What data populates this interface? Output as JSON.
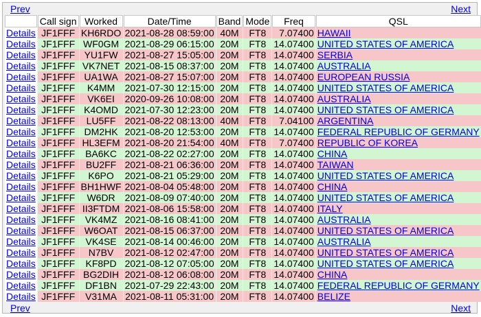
{
  "nav": {
    "prev": "Prev",
    "next": "Next"
  },
  "headers": [
    "",
    "Call sign",
    "Worked",
    "Date/Time",
    "Band",
    "Mode",
    "Freq",
    "QSL"
  ],
  "rows": [
    {
      "details": "Details",
      "call": "JF1FFF",
      "worked": "KH6RDO",
      "datetime": "2021-08-28 08:59:00",
      "band": "40M",
      "mode": "FT8",
      "freq": "7.07400",
      "qsl": "HAWAII",
      "color": "pink"
    },
    {
      "details": "Details",
      "call": "JF1FFF",
      "worked": "WF0GM",
      "datetime": "2021-08-29 06:15:00",
      "band": "20M",
      "mode": "FT8",
      "freq": "14.07400",
      "qsl": "UNITED STATES OF AMERICA",
      "color": "green"
    },
    {
      "details": "Details",
      "call": "JF1FFF",
      "worked": "YU1FW",
      "datetime": "2021-08-27 15:05:00",
      "band": "20M",
      "mode": "FT8",
      "freq": "14.07400",
      "qsl": "SERBIA",
      "color": "pink"
    },
    {
      "details": "Details",
      "call": "JF1FFF",
      "worked": "VK7NET",
      "datetime": "2021-08-15 08:37:00",
      "band": "20M",
      "mode": "FT8",
      "freq": "14.07400",
      "qsl": "AUSTRALIA",
      "color": "green"
    },
    {
      "details": "Details",
      "call": "JF1FFF",
      "worked": "UA1WA",
      "datetime": "2021-08-27 15:07:00",
      "band": "20M",
      "mode": "FT8",
      "freq": "14.07400",
      "qsl": "EUROPEAN RUSSIA",
      "color": "pink"
    },
    {
      "details": "Details",
      "call": "JF1FFF",
      "worked": "K4MM",
      "datetime": "2021-07-30 12:15:00",
      "band": "20M",
      "mode": "FT8",
      "freq": "14.07400",
      "qsl": "UNITED STATES OF AMERICA",
      "color": "green"
    },
    {
      "details": "Details",
      "call": "JF1FFF",
      "worked": "VK6EI",
      "datetime": "2020-09-26 10:08:00",
      "band": "20M",
      "mode": "FT8",
      "freq": "14.07400",
      "qsl": "AUSTRALIA",
      "color": "pink"
    },
    {
      "details": "Details",
      "call": "JF1FFF",
      "worked": "K4OMD",
      "datetime": "2021-07-30 12:23:00",
      "band": "20M",
      "mode": "FT8",
      "freq": "14.07400",
      "qsl": "UNITED STATES OF AMERICA",
      "color": "green"
    },
    {
      "details": "Details",
      "call": "JF1FFF",
      "worked": "LU5FF",
      "datetime": "2021-08-22 08:13:00",
      "band": "40M",
      "mode": "FT8",
      "freq": "7.04100",
      "qsl": "ARGENTINA",
      "color": "pink"
    },
    {
      "details": "Details",
      "call": "JF1FFF",
      "worked": "DM2HK",
      "datetime": "2021-08-20 12:53:00",
      "band": "20M",
      "mode": "FT8",
      "freq": "14.07400",
      "qsl": "FEDERAL REPUBLIC OF GERMANY",
      "color": "green"
    },
    {
      "details": "Details",
      "call": "JF1FFF",
      "worked": "HL3EFM",
      "datetime": "2021-08-20 21:54:00",
      "band": "40M",
      "mode": "FT8",
      "freq": "7.07400",
      "qsl": "REPUBLIC OF KOREA",
      "color": "pink"
    },
    {
      "details": "Details",
      "call": "JF1FFF",
      "worked": "BA6KC",
      "datetime": "2021-08-22 02:27:00",
      "band": "20M",
      "mode": "FT8",
      "freq": "14.07400",
      "qsl": "CHINA",
      "color": "green"
    },
    {
      "details": "Details",
      "call": "JF1FFF",
      "worked": "BU2FF",
      "datetime": "2021-08-21 06:36:00",
      "band": "20M",
      "mode": "FT8",
      "freq": "14.07400",
      "qsl": "TAIWAN",
      "color": "pink"
    },
    {
      "details": "Details",
      "call": "JF1FFF",
      "worked": "K6PO",
      "datetime": "2021-08-21 05:29:00",
      "band": "20M",
      "mode": "FT8",
      "freq": "14.07400",
      "qsl": "UNITED STATES OF AMERICA",
      "color": "green"
    },
    {
      "details": "Details",
      "call": "JF1FFF",
      "worked": "BH1HWF",
      "datetime": "2021-08-04 05:48:00",
      "band": "20M",
      "mode": "FT8",
      "freq": "14.07400",
      "qsl": "CHINA",
      "color": "pink"
    },
    {
      "details": "Details",
      "call": "JF1FFF",
      "worked": "W6DR",
      "datetime": "2021-08-09 07:40:00",
      "band": "20M",
      "mode": "FT8",
      "freq": "14.07400",
      "qsl": "UNITED STATES OF AMERICA",
      "color": "green"
    },
    {
      "details": "Details",
      "call": "JF1FFF",
      "worked": "II3FTDM",
      "datetime": "2021-08-06 15:58:00",
      "band": "20M",
      "mode": "FT8",
      "freq": "14.07400",
      "qsl": "ITALY",
      "color": "pink"
    },
    {
      "details": "Details",
      "call": "JF1FFF",
      "worked": "VK4MZ",
      "datetime": "2021-08-16 08:41:00",
      "band": "20M",
      "mode": "FT8",
      "freq": "14.07400",
      "qsl": "AUSTRALIA",
      "color": "green"
    },
    {
      "details": "Details",
      "call": "JF1FFF",
      "worked": "W6OAT",
      "datetime": "2021-08-15 06:37:00",
      "band": "20M",
      "mode": "FT8",
      "freq": "14.07400",
      "qsl": "UNITED STATES OF AMERICA",
      "color": "pink"
    },
    {
      "details": "Details",
      "call": "JF1FFF",
      "worked": "VK4SE",
      "datetime": "2021-08-14 00:46:00",
      "band": "20M",
      "mode": "FT8",
      "freq": "14.07400",
      "qsl": "AUSTRALIA",
      "color": "green"
    },
    {
      "details": "Details",
      "call": "JF1FFF",
      "worked": "N7BV",
      "datetime": "2021-08-12 02:47:00",
      "band": "20M",
      "mode": "FT8",
      "freq": "14.07400",
      "qsl": "UNITED STATES OF AMERICA",
      "color": "pink"
    },
    {
      "details": "Details",
      "call": "JF1FFF",
      "worked": "KF8PD",
      "datetime": "2021-08-12 07:05:00",
      "band": "20M",
      "mode": "FT8",
      "freq": "14.07400",
      "qsl": "UNITED STATES OF AMERICA",
      "color": "green"
    },
    {
      "details": "Details",
      "call": "JF1FFF",
      "worked": "BG2DIH",
      "datetime": "2021-08-12 06:08:00",
      "band": "20M",
      "mode": "FT8",
      "freq": "14.07400",
      "qsl": "CHINA",
      "color": "pink"
    },
    {
      "details": "Details",
      "call": "JF1FFF",
      "worked": "DF1BN",
      "datetime": "2021-07-29 22:43:00",
      "band": "20M",
      "mode": "FT8",
      "freq": "14.07400",
      "qsl": "FEDERAL REPUBLIC OF GERMANY",
      "color": "green"
    },
    {
      "details": "Details",
      "call": "JF1FFF",
      "worked": "V31MA",
      "datetime": "2021-08-11 05:31:00",
      "band": "20M",
      "mode": "FT8",
      "freq": "14.07400",
      "qsl": "BELIZE",
      "color": "pink"
    }
  ],
  "colors": {
    "pink_row": "#f7c6c9",
    "green_row": "#d2f5d2",
    "link": "#0000ee",
    "panel": "#f0f0f0"
  }
}
